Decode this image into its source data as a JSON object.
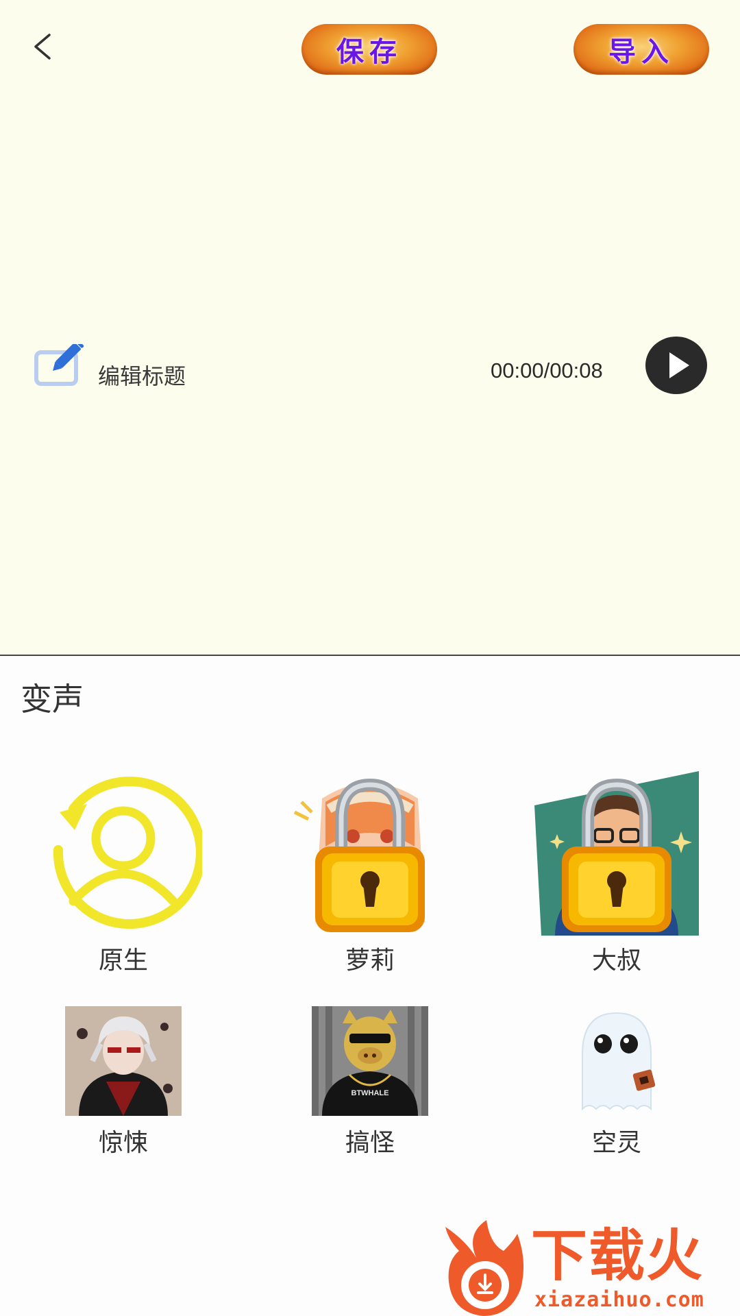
{
  "header": {
    "save_label": "保存",
    "import_label": "导入"
  },
  "editor": {
    "title_placeholder": "编辑标题",
    "time_display": "00:00/00:08"
  },
  "voice_panel": {
    "title": "变声",
    "items": [
      {
        "label": "原生",
        "icon": "original-voice-icon",
        "locked": false
      },
      {
        "label": "萝莉",
        "icon": "loli-avatar",
        "locked": true
      },
      {
        "label": "大叔",
        "icon": "uncle-avatar",
        "locked": true
      },
      {
        "label": "惊悚",
        "icon": "thriller-avatar",
        "locked": false
      },
      {
        "label": "搞怪",
        "icon": "funny-pig-avatar",
        "locked": false
      },
      {
        "label": "空灵",
        "icon": "ghost-avatar",
        "locked": false
      }
    ]
  },
  "watermark": {
    "title": "下载火",
    "url": "xiazaihuo.com"
  },
  "colors": {
    "editor_bg": "#fdfdee",
    "pill_text": "#6a16e6",
    "pill_bg": "#f0a232",
    "icon_yellow": "#f2e62a",
    "lock_gold": "#f6b800",
    "edit_icon_blue": "#2f6fd8",
    "watermark": "#ef5a2a"
  }
}
